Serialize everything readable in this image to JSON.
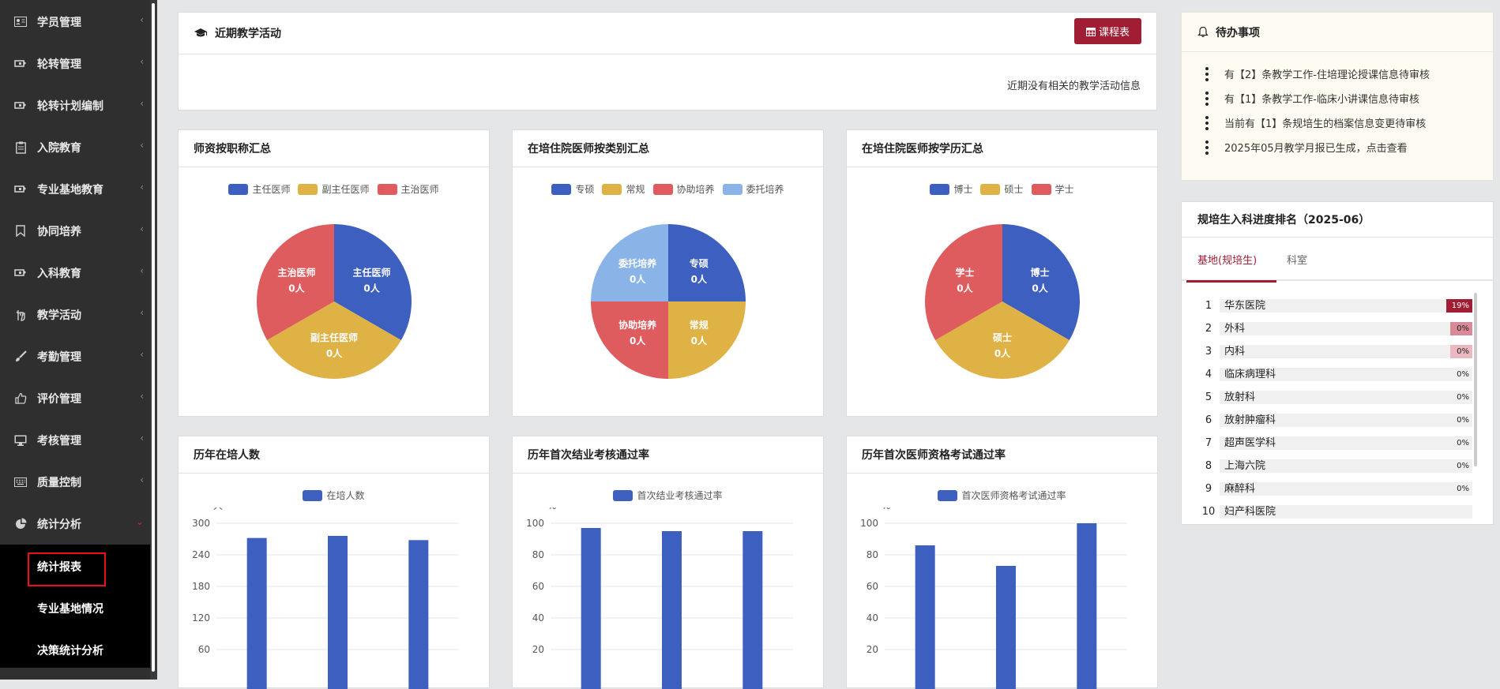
{
  "sidebar": {
    "items": [
      {
        "label": "学员管理",
        "icon": "id-card-icon"
      },
      {
        "label": "轮转管理",
        "icon": "rotate-icon"
      },
      {
        "label": "轮转计划编制",
        "icon": "rotate-icon"
      },
      {
        "label": "入院教育",
        "icon": "clipboard-icon"
      },
      {
        "label": "专业基地教育",
        "icon": "rotate-icon"
      },
      {
        "label": "协同培养",
        "icon": "bookmark-icon"
      },
      {
        "label": "入科教育",
        "icon": "rotate-icon"
      },
      {
        "label": "教学活动",
        "icon": "hand-icon"
      },
      {
        "label": "考勤管理",
        "icon": "brush-icon"
      },
      {
        "label": "评价管理",
        "icon": "thumbs-up-icon"
      },
      {
        "label": "考核管理",
        "icon": "monitor-icon"
      },
      {
        "label": "质量控制",
        "icon": "keyboard-icon"
      },
      {
        "label": "统计分析",
        "icon": "pie-chart-icon"
      }
    ],
    "submenu": [
      "统计报表",
      "专业基地情况",
      "决策统计分析"
    ]
  },
  "activity": {
    "title": "近期教学活动",
    "button": "课程表",
    "empty": "近期没有相关的教学活动信息"
  },
  "pies": [
    {
      "title": "师资按职称汇总",
      "legend": [
        "主任医师",
        "副主任医师",
        "主治医师"
      ],
      "slices": [
        {
          "name": "主任医师",
          "value": "0人"
        },
        {
          "name": "副主任医师",
          "value": "0人"
        },
        {
          "name": "主治医师",
          "value": "0人"
        }
      ]
    },
    {
      "title": "在培住院医师按类别汇总",
      "legend": [
        "专硕",
        "常规",
        "协助培养",
        "委托培养"
      ],
      "slices": [
        {
          "name": "专硕",
          "value": "0人"
        },
        {
          "name": "常规",
          "value": "0人"
        },
        {
          "name": "协助培养",
          "value": "0人"
        },
        {
          "name": "委托培养",
          "value": "0人"
        }
      ]
    },
    {
      "title": "在培住院医师按学历汇总",
      "legend": [
        "博士",
        "硕士",
        "学士"
      ],
      "slices": [
        {
          "name": "博士",
          "value": "0人"
        },
        {
          "name": "硕士",
          "value": "0人"
        },
        {
          "name": "学士",
          "value": "0人"
        }
      ]
    }
  ],
  "colors": {
    "blue": "#3d5fbf",
    "yellow": "#dfb245",
    "red": "#de5b5e",
    "lightblue": "#8ab4e8",
    "accent": "#a11d33"
  },
  "chart_data": [
    {
      "type": "bar",
      "title": "历年在培人数",
      "series": [
        {
          "name": "在培人数",
          "values": [
            272,
            276,
            268
          ]
        }
      ],
      "ylabel": "人",
      "yticks": [
        60,
        120,
        180,
        240,
        300
      ],
      "ylim": [
        0,
        300
      ]
    },
    {
      "type": "bar",
      "title": "历年首次结业考核通过率",
      "series": [
        {
          "name": "首次结业考核通过率",
          "values": [
            97,
            95,
            95
          ]
        }
      ],
      "ylabel": "%",
      "yticks": [
        20,
        40,
        60,
        80,
        100
      ],
      "ylim": [
        0,
        100
      ]
    },
    {
      "type": "bar",
      "title": "历年首次医师资格考试通过率",
      "series": [
        {
          "name": "首次医师资格考试通过率",
          "values": [
            86,
            73,
            100
          ]
        }
      ],
      "ylabel": "%",
      "yticks": [
        20,
        40,
        60,
        80,
        100
      ],
      "ylim": [
        0,
        100
      ]
    }
  ],
  "todo": {
    "title": "待办事项",
    "items": [
      "有【2】条教学工作-住培理论授课信息待审核",
      "有【1】条教学工作-临床小讲课信息待审核",
      "当前有【1】条规培生的档案信息变更待审核",
      "2025年05月教学月报已生成，点击查看"
    ]
  },
  "ranking": {
    "title": "规培生入科进度排名（2025-06）",
    "tabs": [
      "基地(规培生)",
      "科室"
    ],
    "rows": [
      {
        "rank": "1",
        "name": "华东医院",
        "pct": "19%",
        "value": 19
      },
      {
        "rank": "2",
        "name": "外科",
        "pct": "0%",
        "value": 0.4
      },
      {
        "rank": "3",
        "name": "内科",
        "pct": "0%",
        "value": 0.3
      },
      {
        "rank": "4",
        "name": "临床病理科",
        "pct": "0%",
        "value": 0
      },
      {
        "rank": "5",
        "name": "放射科",
        "pct": "0%",
        "value": 0
      },
      {
        "rank": "6",
        "name": "放射肿瘤科",
        "pct": "0%",
        "value": 0
      },
      {
        "rank": "7",
        "name": "超声医学科",
        "pct": "0%",
        "value": 0
      },
      {
        "rank": "8",
        "name": "上海六院",
        "pct": "0%",
        "value": 0
      },
      {
        "rank": "9",
        "name": "麻醉科",
        "pct": "0%",
        "value": 0
      },
      {
        "rank": "10",
        "name": "妇产科医院",
        "pct": "",
        "value": 0
      }
    ]
  }
}
